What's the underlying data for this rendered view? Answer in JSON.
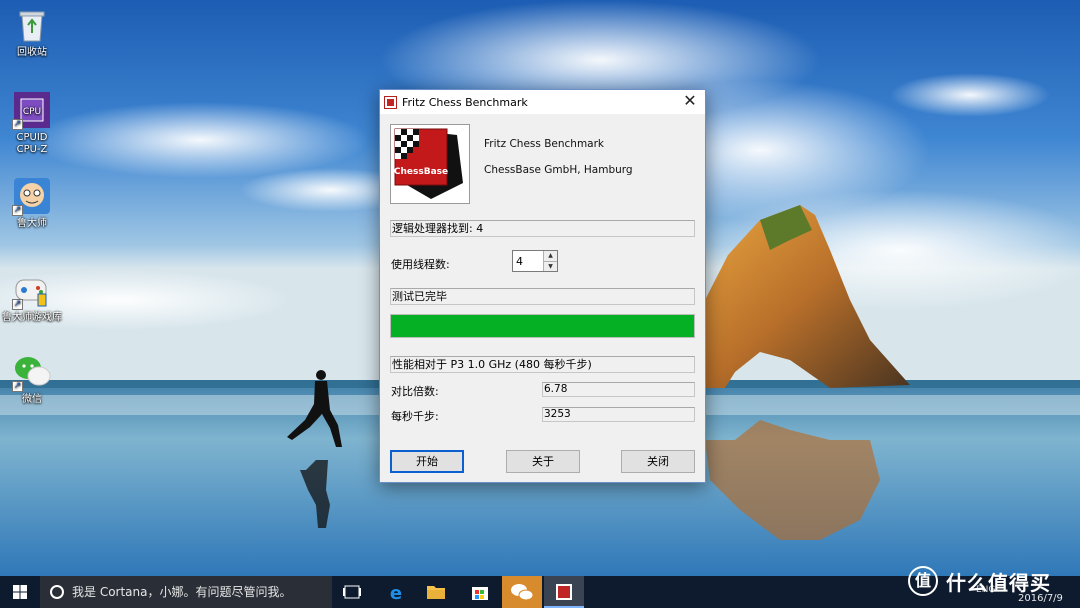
{
  "desktop": {
    "icons": [
      {
        "label": "回收站"
      },
      {
        "label": "CPUID\nCPU-Z"
      },
      {
        "label": "鲁大师"
      },
      {
        "label": "鲁大师游戏库"
      },
      {
        "label": "微信"
      }
    ]
  },
  "dialog": {
    "title": "Fritz Chess Benchmark",
    "logo_text": "ChessBase",
    "product_name": "Fritz Chess Benchmark",
    "company": "ChessBase GmbH, Hamburg",
    "processors_found": "逻辑处理器找到: 4",
    "threads_label": "使用线程数:",
    "threads_value": "4",
    "status": "测试已完毕",
    "progress_percent": 100,
    "performance_text": "性能相对于 P3 1.0 GHz (480 每秒千步)",
    "ratio_label": "对比倍数:",
    "ratio_value": "6.78",
    "kns_label": "每秒千步:",
    "kns_value": "3253",
    "buttons": {
      "start": "开始",
      "about": "关于",
      "close": "关闭"
    }
  },
  "taskbar": {
    "search_placeholder": "我是 Cortana，小娜。有问题尽管问我。",
    "ime": "ENG",
    "date": "2016/7/9"
  },
  "watermark": {
    "symbol": "值",
    "text": "什么值得买"
  },
  "colors": {
    "progress": "#06b025",
    "taskbar": "#0e1b2e",
    "accent": "#0a60d0"
  }
}
